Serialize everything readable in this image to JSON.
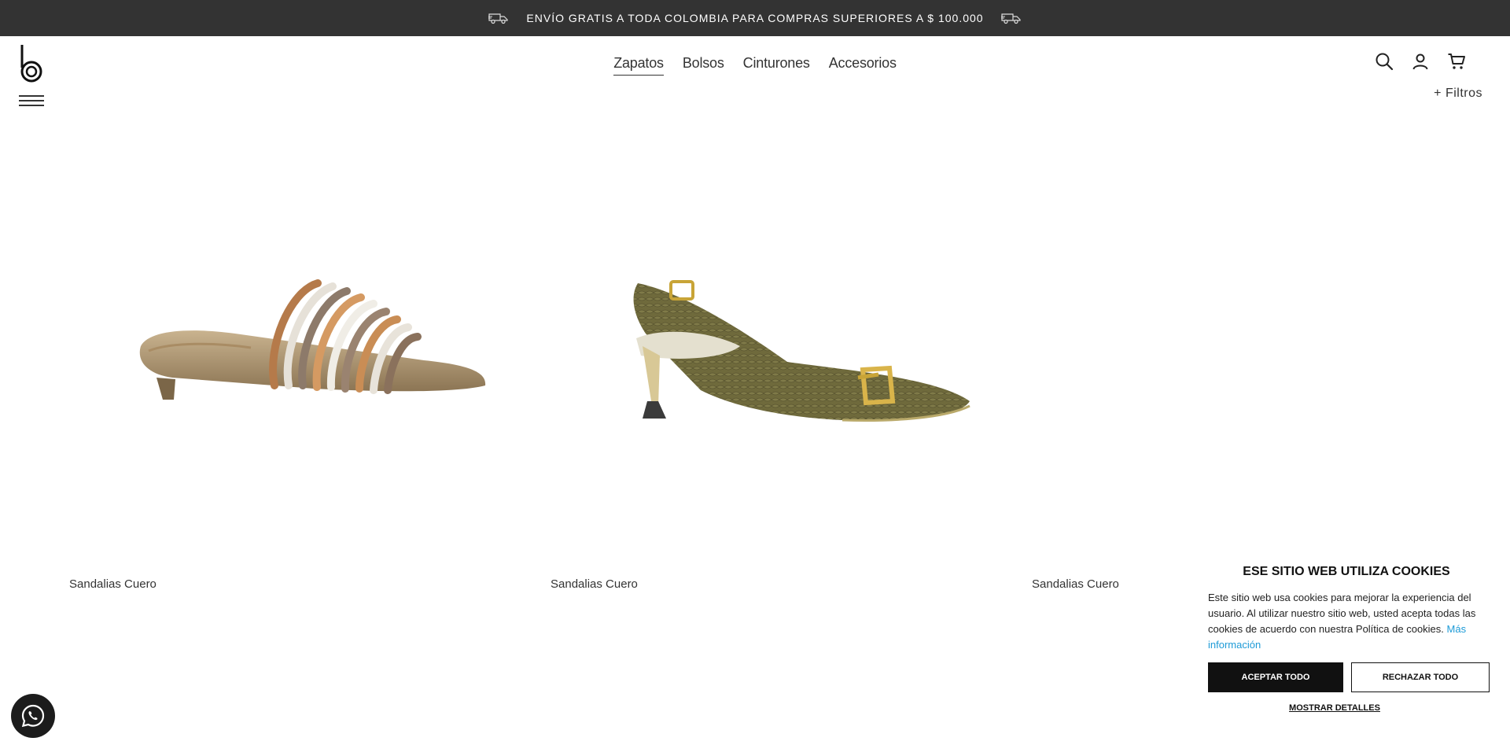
{
  "announcement": {
    "text": "ENVÍO GRATIS A TODA COLOMBIA PARA COMPRAS SUPERIORES A $ 100.000",
    "icon": "truck-icon"
  },
  "header": {
    "logo_icon": "b-logo",
    "menu_icon": "hamburger-icon",
    "nav": [
      {
        "label": "Zapatos",
        "active": true
      },
      {
        "label": "Bolsos",
        "active": false
      },
      {
        "label": "Cinturones",
        "active": false
      },
      {
        "label": "Accesorios",
        "active": false
      }
    ],
    "icons": [
      "search-icon",
      "user-icon",
      "cart-icon"
    ],
    "filters_label": "+ Filtros"
  },
  "products": [
    {
      "name": "Sandalias Cuero",
      "image": "metallic-striped-slide-sandal"
    },
    {
      "name": "Sandalias Cuero",
      "image": "olive-snakeskin-slingback-heel"
    },
    {
      "name": "Sandalias Cuero",
      "image": ""
    }
  ],
  "cookie": {
    "title": "ESE SITIO WEB UTILIZA COOKIES",
    "text": "Este sitio web usa cookies para mejorar la experiencia del usuario. Al utilizar nuestro sitio web, usted acepta todas las cookies de acuerdo con nuestra Política de cookies.",
    "link": "Más información",
    "accept": "ACEPTAR TODO",
    "reject": "RECHAZAR TODO",
    "details": "MOSTRAR DETALLES"
  },
  "whatsapp_icon": "whatsapp-icon",
  "colors": {
    "topbar": "#333333",
    "accent_link": "#1e9bd7",
    "button_dark": "#111111"
  }
}
